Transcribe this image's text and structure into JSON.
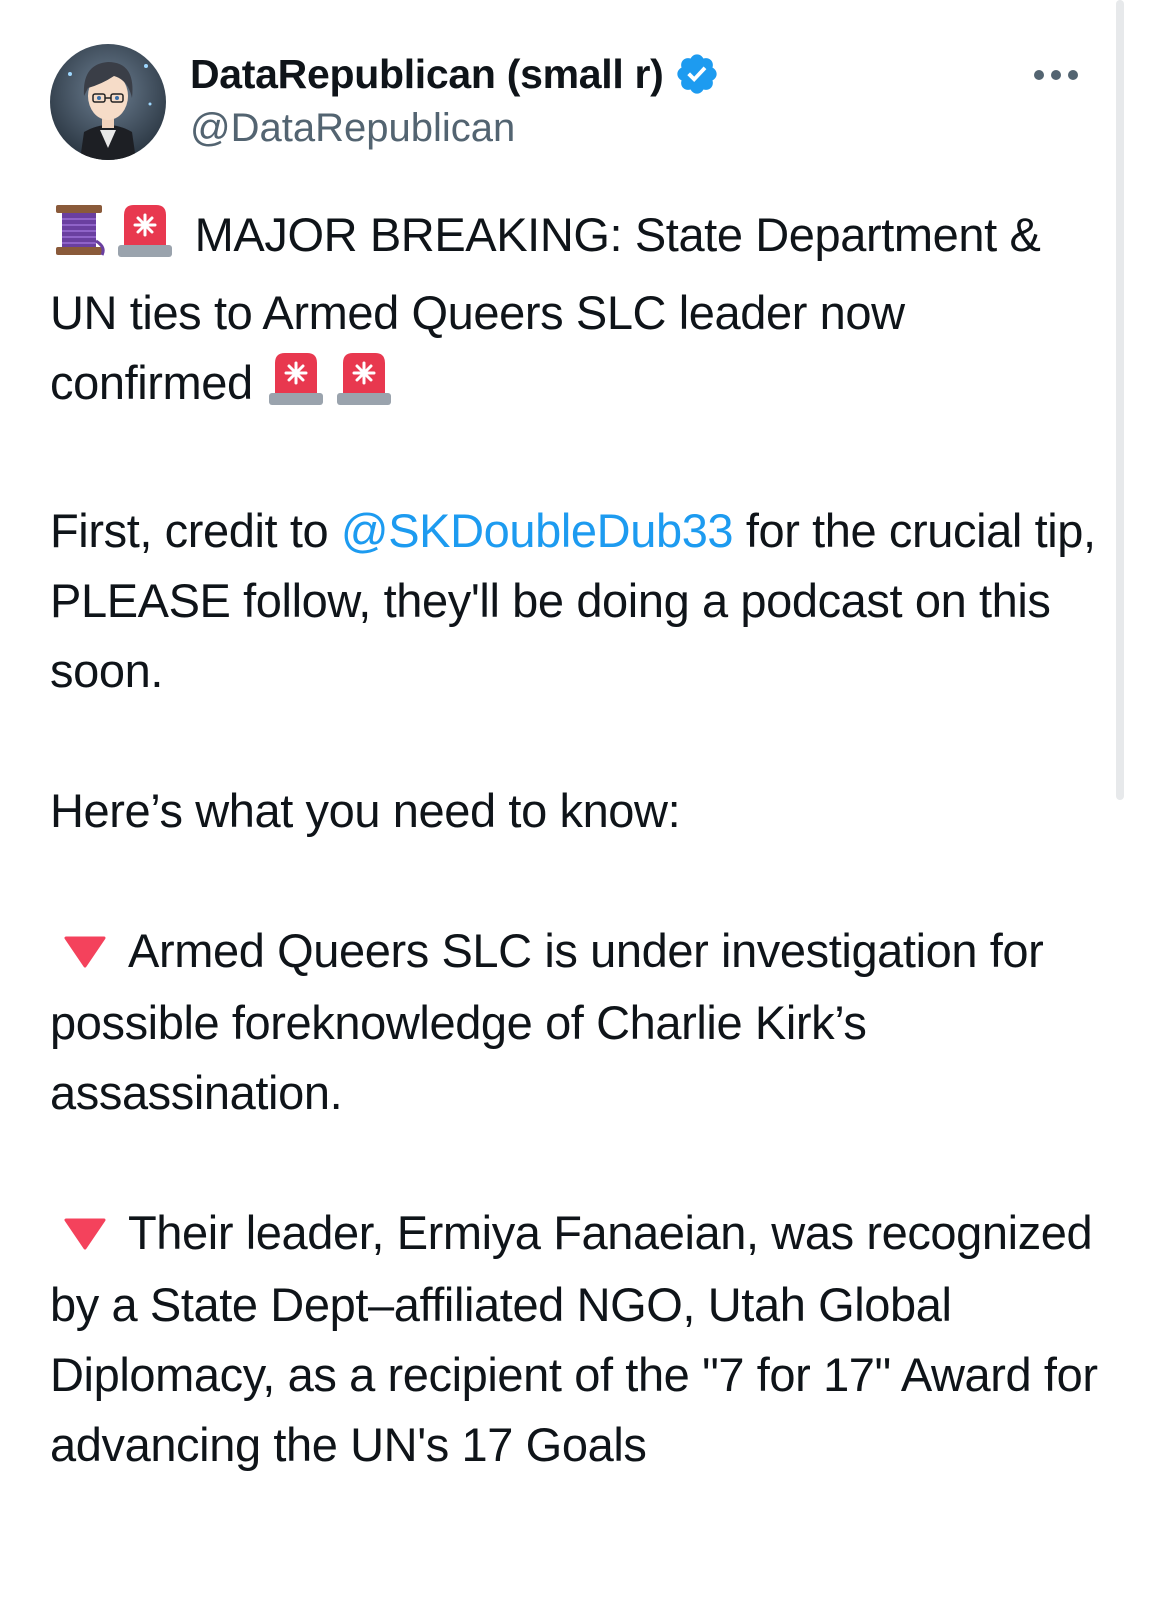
{
  "author": {
    "display_name": "DataRepublican (small r)",
    "handle": "@DataRepublican",
    "verified": true,
    "avatar_icon": "anime-character-avatar"
  },
  "icons": {
    "verified": "verified-badge-icon",
    "more": "more-options-icon",
    "thread": "thread-spool-emoji",
    "siren": "police-siren-emoji",
    "bullet": "red-triangle-down-emoji"
  },
  "colors": {
    "link": "#1d9bf0",
    "text": "#0f1419",
    "secondary": "#536471",
    "verified": "#1d9bf0",
    "bullet": "#f4425c"
  },
  "post": {
    "headline": "MAJOR BREAKING: State Department & UN ties to Armed Queers SLC leader now confirmed",
    "credit_before": "First, credit to ",
    "credit_mention": "@SKDoubleDub33",
    "credit_after": " for the crucial tip, PLEASE follow, they'll be doing a podcast on this soon.",
    "intro": "Here’s what you need to know:",
    "bullets": [
      "Armed Queers SLC is under investigation for possible foreknowledge of Charlie Kirk’s assassination.",
      "Their leader, Ermiya Fanaeian, was recognized by a State Dept–affiliated NGO, Utah Global Diplomacy, as a recipient of the \"7 for 17\" Award for advancing the UN's 17 Goals"
    ]
  }
}
